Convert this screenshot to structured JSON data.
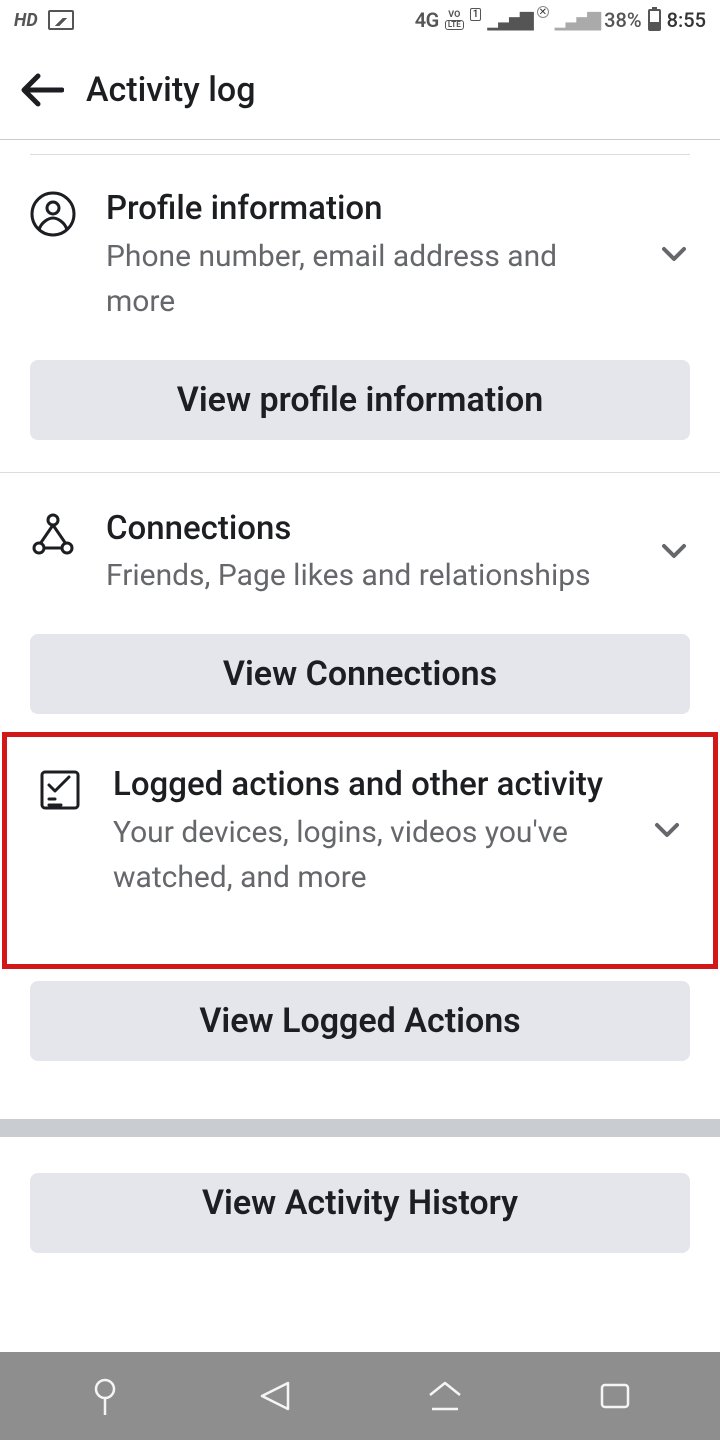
{
  "status": {
    "hd": "HD",
    "net": "4G",
    "batt": "38%",
    "time": "8:55"
  },
  "header": {
    "title": "Activity log"
  },
  "sections": [
    {
      "title": "Profile information",
      "sub": "Phone number, email address and more",
      "button": "View profile information"
    },
    {
      "title": "Connections",
      "sub": "Friends, Page likes and relationships",
      "button": "View Connections"
    },
    {
      "title": "Logged actions and other activity",
      "sub": "Your devices, logins, videos you've watched, and more",
      "button": "View Logged Actions"
    }
  ],
  "bottom_button": "View Activity History"
}
